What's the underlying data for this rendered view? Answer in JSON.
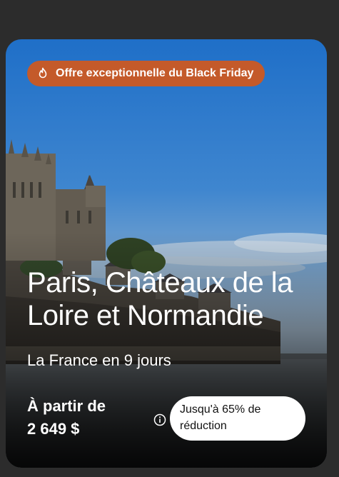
{
  "card": {
    "badge_label": "Offre exceptionnelle du Black Friday",
    "badge_icon": "flame-icon",
    "badge_color": "#c45a2a",
    "title": "Paris, Châteaux de la Loire et Normandie",
    "subtitle": "La France en 9 jours",
    "price_prefix": "À partir de",
    "price": "2 649 $",
    "info_icon": "info-icon",
    "discount": "Jusqu'à 65% de réduction"
  }
}
